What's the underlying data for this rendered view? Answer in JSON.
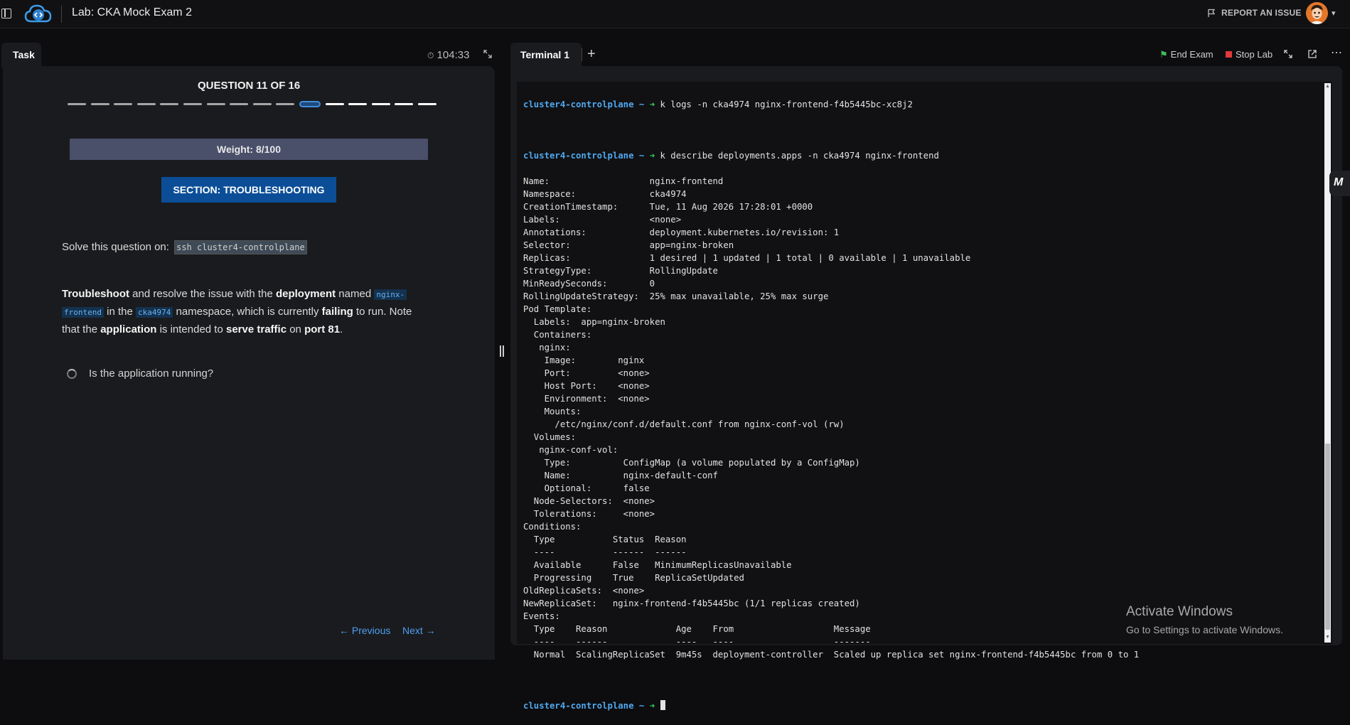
{
  "header": {
    "lab_title": "Lab: CKA Mock Exam 2",
    "report_label": "REPORT AN ISSUE"
  },
  "task_panel": {
    "tab_label": "Task",
    "timer": "104:33",
    "question_title": "QUESTION 11 OF 16",
    "progress": {
      "total": 16,
      "current": 11
    },
    "weight": "Weight: 8/100",
    "section": "SECTION: TROUBLESHOOTING",
    "solve_prefix": "Solve this question on:",
    "solve_code": "ssh cluster4-controlplane",
    "desc": {
      "t1": "Troubleshoot",
      "t2": " and resolve the issue with the ",
      "t3": "deployment",
      "t4": " named ",
      "c1a": "nginx-",
      "c1b": "frontend",
      "t5": " in the ",
      "c2": "cka4974",
      "t6": " namespace, which is currently ",
      "t7": "failing",
      "t8": " to run. Note that the ",
      "t9": "application",
      "t10": " is intended to ",
      "t11": "serve traffic",
      "t12": " on ",
      "t13": "port 81",
      "t14": "."
    },
    "check_label": "Is the application running?",
    "prev_label": "← Previous",
    "next_label": "Next →"
  },
  "terminal_panel": {
    "tab_label": "Terminal 1",
    "end_exam_label": "End Exam",
    "stop_lab_label": "Stop Lab",
    "prompt_host": "cluster4-controlplane ~",
    "prompt_arrow": "➜",
    "cmd1": "k logs -n cka4974 nginx-frontend-f4b5445bc-xc8j2",
    "cmd2": "k describe deployments.apps -n cka4974 nginx-frontend",
    "output": [
      "Name:                   nginx-frontend",
      "Namespace:              cka4974",
      "CreationTimestamp:      Tue, 11 Aug 2026 17:28:01 +0000",
      "Labels:                 <none>",
      "Annotations:            deployment.kubernetes.io/revision: 1",
      "Selector:               app=nginx-broken",
      "Replicas:               1 desired | 1 updated | 1 total | 0 available | 1 unavailable",
      "StrategyType:           RollingUpdate",
      "MinReadySeconds:        0",
      "RollingUpdateStrategy:  25% max unavailable, 25% max surge",
      "Pod Template:",
      "  Labels:  app=nginx-broken",
      "  Containers:",
      "   nginx:",
      "    Image:        nginx",
      "    Port:         <none>",
      "    Host Port:    <none>",
      "    Environment:  <none>",
      "    Mounts:",
      "      /etc/nginx/conf.d/default.conf from nginx-conf-vol (rw)",
      "  Volumes:",
      "   nginx-conf-vol:",
      "    Type:          ConfigMap (a volume populated by a ConfigMap)",
      "    Name:          nginx-default-conf",
      "    Optional:      false",
      "  Node-Selectors:  <none>",
      "  Tolerations:     <none>",
      "Conditions:",
      "  Type           Status  Reason",
      "  ----           ------  ------",
      "  Available      False   MinimumReplicasUnavailable",
      "  Progressing    True    ReplicaSetUpdated",
      "OldReplicaSets:  <none>",
      "NewReplicaSet:   nginx-frontend-f4b5445bc (1/1 replicas created)",
      "Events:",
      "  Type    Reason             Age    From                   Message",
      "  ----    ------             ----   ----                   -------",
      "  Normal  ScalingReplicaSet  9m45s  deployment-controller  Scaled up replica set nginx-frontend-f4b5445bc from 0 to 1"
    ]
  },
  "watermark": {
    "line1": "Activate Windows",
    "line2": "Go to Settings to activate Windows."
  },
  "side_badge": "M"
}
